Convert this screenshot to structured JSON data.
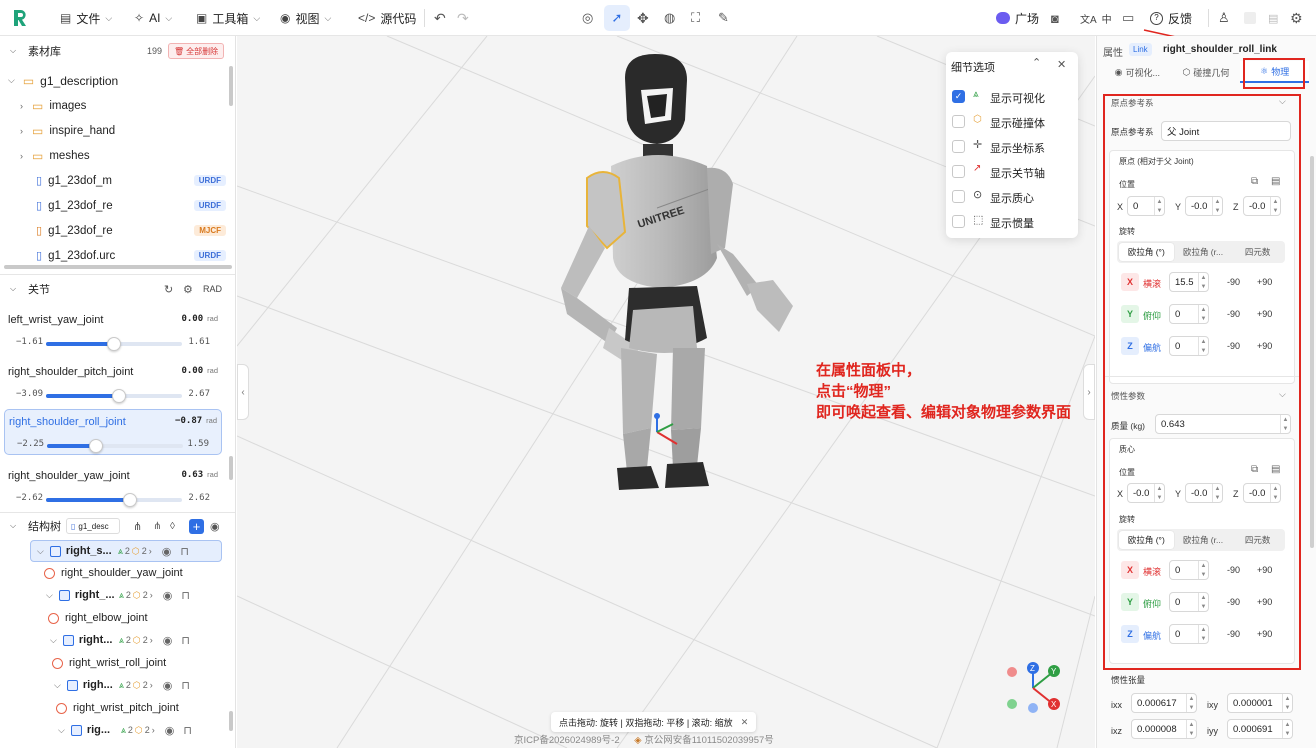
{
  "topbar": {
    "file": "文件",
    "ai": "AI",
    "toolbox": "工具箱",
    "view": "视图",
    "source": "源代码",
    "plaza": "广场",
    "lang": "中",
    "feedback": "反馈"
  },
  "assets": {
    "title": "素材库",
    "count": "199",
    "delete_all": "全部删除",
    "root": "g1_description",
    "folders": [
      "images",
      "inspire_hand",
      "meshes"
    ],
    "files": [
      {
        "name": "g1_23dof_m",
        "badge": "URDF"
      },
      {
        "name": "g1_23dof_re",
        "badge": "URDF"
      },
      {
        "name": "g1_23dof_re",
        "badge": "MJCF"
      },
      {
        "name": "g1_23dof.urc",
        "badge": "URDF"
      }
    ]
  },
  "joints": {
    "title": "关节",
    "unit_toggle": "RAD",
    "items": [
      {
        "name": "left_wrist_yaw_joint",
        "value": "0.00",
        "unit": "rad",
        "min": "−1.61",
        "max": "1.61",
        "fraction": 0.5
      },
      {
        "name": "right_shoulder_pitch_joint",
        "value": "0.00",
        "unit": "rad",
        "min": "−3.09",
        "max": "2.67",
        "fraction": 0.536
      },
      {
        "name": "right_shoulder_roll_joint",
        "value": "−0.87",
        "unit": "rad",
        "min": "−2.25",
        "max": "1.59",
        "fraction": 0.36
      },
      {
        "name": "right_shoulder_yaw_joint",
        "value": "0.63",
        "unit": "rad",
        "min": "−2.62",
        "max": "2.62",
        "fraction": 0.62
      }
    ]
  },
  "structure": {
    "title": "结构树",
    "file_chip": "g1_desc",
    "rows": [
      {
        "kind": "link",
        "label": "right_s...",
        "count": "2",
        "count2": "2"
      },
      {
        "kind": "joint",
        "label": "right_shoulder_yaw_joint"
      },
      {
        "kind": "link",
        "label": "right_...",
        "count": "2",
        "count2": "2"
      },
      {
        "kind": "joint",
        "label": "right_elbow_joint"
      },
      {
        "kind": "link",
        "label": "right...",
        "count": "2",
        "count2": "2"
      },
      {
        "kind": "joint",
        "label": "right_wrist_roll_joint"
      },
      {
        "kind": "link",
        "label": "righ...",
        "count": "2",
        "count2": "2"
      },
      {
        "kind": "joint",
        "label": "right_wrist_pitch_joint"
      },
      {
        "kind": "link",
        "label": "rig...",
        "count": "2",
        "count2": "2"
      }
    ]
  },
  "detail_options": {
    "title": "细节选项",
    "items": [
      {
        "label": "显示可视化",
        "checked": true
      },
      {
        "label": "显示碰撞体",
        "checked": false
      },
      {
        "label": "显示坐标系",
        "checked": false
      },
      {
        "label": "显示关节轴",
        "checked": false
      },
      {
        "label": "显示质心",
        "checked": false
      },
      {
        "label": "显示惯量",
        "checked": false
      }
    ]
  },
  "annotation": {
    "line1": "在属性面板中，",
    "line2": "点击“物理”",
    "line3": "即可唤起查看、编辑对象物理参数界面"
  },
  "viewport": {
    "hint": "点击拖动: 旋转 | 双指拖动: 平移 | 滚动: 缩放",
    "icp": "京ICP备2026024989号-2",
    "police": "京公网安备11011502039957号",
    "chest_logo": "UNITREE"
  },
  "properties": {
    "title": "属性",
    "type_badge": "Link",
    "name": "right_shoulder_roll_link",
    "tabs": [
      "可视化...",
      "碰撞几何",
      "物理"
    ],
    "origin_section": "原点参考系",
    "origin_label": "原点参考系",
    "origin_value": "父 Joint",
    "origin_sub": "原点 (相对于父 Joint)",
    "position_label": "位置",
    "pos": {
      "x": "0",
      "y": "-0.0",
      "z": "-0.0"
    },
    "rotation_label": "旋转",
    "rot_tabs": [
      "欧拉角 (°)",
      "欧拉角 (r...",
      "四元数"
    ],
    "rot_rows": [
      {
        "axis": "X",
        "name": "横滚",
        "value": "15.5",
        "min": "-90",
        "max": "+90"
      },
      {
        "axis": "Y",
        "name": "俯仰",
        "value": "0",
        "min": "-90",
        "max": "+90"
      },
      {
        "axis": "Z",
        "name": "偏航",
        "value": "0",
        "min": "-90",
        "max": "+90"
      }
    ],
    "inertia_section": "惯性参数",
    "mass_label": "质量 (kg)",
    "mass_value": "0.643",
    "com_label": "质心",
    "com_pos": {
      "x": "-0.0",
      "y": "-0.0",
      "z": "-0.0"
    },
    "com_rot_rows": [
      {
        "axis": "X",
        "name": "横滚",
        "value": "0",
        "min": "-90",
        "max": "+90"
      },
      {
        "axis": "Y",
        "name": "俯仰",
        "value": "0",
        "min": "-90",
        "max": "+90"
      },
      {
        "axis": "Z",
        "name": "偏航",
        "value": "0",
        "min": "-90",
        "max": "+90"
      }
    ],
    "tensor_label": "惯性张量",
    "tensor": {
      "ixx_label": "ixx",
      "ixx": "0.000617",
      "ixy_label": "ixy",
      "ixy": "0.000001",
      "ixz_label": "ixz",
      "ixz": "0.000008",
      "iyy_label": "iyy",
      "iyy": "0.000691"
    }
  },
  "colors": {
    "accent": "#2f6fe4",
    "annotation_red": "#e0261f"
  }
}
